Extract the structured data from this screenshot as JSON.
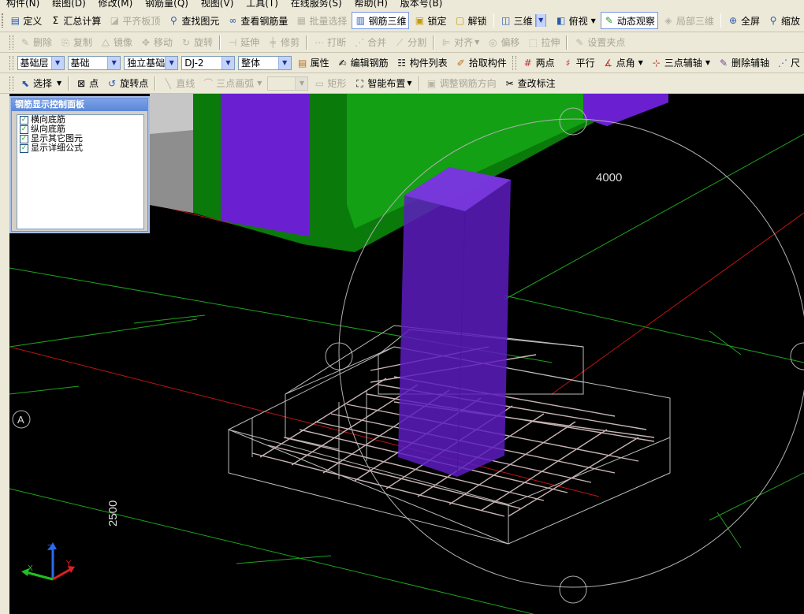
{
  "menu": [
    "构件(N)",
    "绘图(D)",
    "修改(M)",
    "钢筋量(Q)",
    "视图(V)",
    "工具(T)",
    "在线服务(S)",
    "帮助(H)",
    "版本号(B)"
  ],
  "toolbar1": {
    "define": "定义",
    "sum": "汇总计算",
    "align_top": "平齐板顶",
    "find": "查找图元",
    "view_rebar": "查看钢筋量",
    "batch_select": "批量选择",
    "rebar_3d": "钢筋三维",
    "lock": "锁定",
    "unlock": "解锁",
    "view_3d": "三维",
    "top_view": "俯视",
    "dynamic": "动态观察",
    "local_3d": "局部三维",
    "fullscreen": "全屏",
    "zoom": "缩放"
  },
  "toolbar2": {
    "delete": "删除",
    "copy": "复制",
    "mirror": "镜像",
    "move": "移动",
    "rotate": "旋转",
    "extend": "延伸",
    "trim": "修剪",
    "break": "打断",
    "merge": "合并",
    "split": "分割",
    "align": "对齐",
    "offset": "偏移",
    "stretch": "拉伸",
    "set_grip": "设置夹点"
  },
  "toolbar3": {
    "floor": "基础层",
    "category": "基础",
    "type": "独立基础",
    "name": "DJ-2",
    "part": "整体",
    "props": "属性",
    "edit_rebar": "编辑钢筋",
    "list": "构件列表",
    "pick": "拾取构件",
    "two_points": "两点",
    "parallel": "平行",
    "point_angle": "点角",
    "three_point_axis": "三点辅轴",
    "delete_axis": "删除辅轴",
    "ruler": "尺"
  },
  "toolbar4": {
    "select": "选择",
    "point": "点",
    "rotate_point": "旋转点",
    "line": "直线",
    "arc": "三点画弧",
    "rect": "矩形",
    "smart": "智能布置",
    "adjust_dir": "调整钢筋方向",
    "edit_label": "查改标注"
  },
  "panel": {
    "title": "钢筋显示控制面板",
    "items": [
      "横向底筋",
      "纵向底筋",
      "显示其它图元",
      "显示详细公式"
    ]
  },
  "viewport": {
    "dim_top": "4000",
    "dim_left": "2500",
    "axis_label": "A"
  },
  "colors": {
    "chrome": "#ece9d8",
    "column": "#5d1cc0",
    "beam": "#0a7a0a",
    "grid_line": "#1ea31e",
    "rebar": "#c8b4b4",
    "wire": "#b4b4b4"
  }
}
